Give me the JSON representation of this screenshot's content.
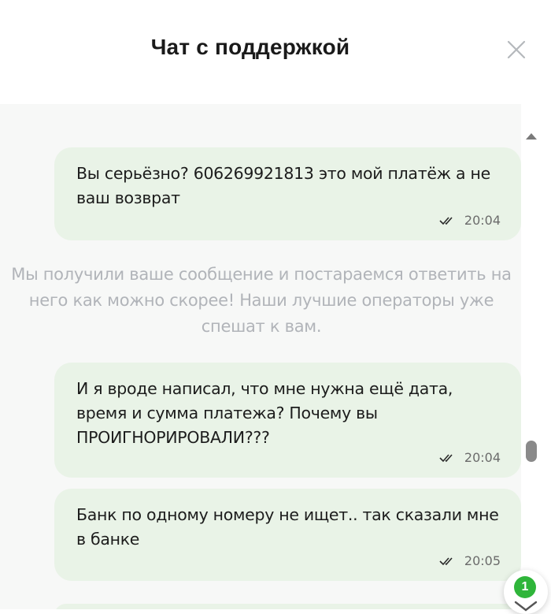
{
  "header": {
    "title": "Чат с поддержкой",
    "close_icon": "close-icon"
  },
  "messages": [
    {
      "text": "Вы серьёзно? 606269921813 это мой платёж а не ваш возврат",
      "time": "20:04",
      "status_icon": "double-check-icon"
    },
    {
      "text": "И я вроде написал, что мне нужна ещё дата, время и сумма платежа? Почему вы ПРОИГНОРИРОВАЛИ???",
      "time": "20:04",
      "status_icon": "double-check-icon"
    },
    {
      "text": "Банк по одному номеру не ищет.. так сказали мне в банке",
      "time": "20:05",
      "status_icon": "double-check-icon"
    }
  ],
  "system_message": {
    "text": "Мы получили ваше сообщение и постараемся ответить на него как можно скорее! Наши лучшие операторы уже спешат к вам."
  },
  "scroll_down": {
    "unread_count": "1",
    "icon": "chevron-down-icon"
  },
  "colors": {
    "bubble": "#e9f3e7",
    "chat_background": "#f7f8f7",
    "system_text": "#b1b4b9",
    "badge": "#2fb53a"
  }
}
